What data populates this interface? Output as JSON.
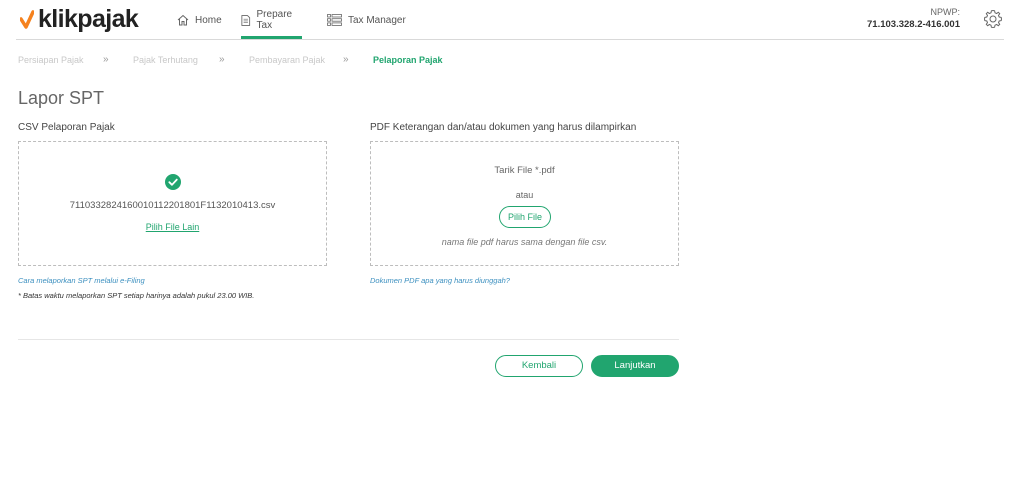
{
  "brand": {
    "name": "klikpajak",
    "accent": "#21a56f",
    "logo_mark_color": "#f5821f"
  },
  "nav": {
    "home": {
      "label": "Home",
      "icon": "home-icon"
    },
    "prepare_tax": {
      "label": "Prepare Tax",
      "icon": "document-icon",
      "active": true
    },
    "tax_manager": {
      "label": "Tax Manager",
      "icon": "list-icon"
    }
  },
  "account": {
    "npwp_label": "NPWP:",
    "npwp_value": "71.103.328.2-416.001",
    "settings_icon": "gear-icon"
  },
  "breadcrumb": {
    "steps": [
      "Persiapan Pajak",
      "Pajak Terhutang",
      "Pembayaran Pajak",
      "Pelaporan Pajak"
    ],
    "separator": "»",
    "active_index": 3
  },
  "page": {
    "title": "Lapor SPT"
  },
  "csv_section": {
    "label": "CSV Pelaporan Pajak",
    "status_icon": "check-circle-icon",
    "filename": "711033282416001011220180 1F1132010413.csv",
    "pick_other_label": "Pilih File Lain",
    "help_link": "Cara melaporkan SPT melalui e-Filing",
    "deadline_note": "* Batas waktu melaporkan SPT setiap harinya adalah pukul 23.00 WIB."
  },
  "pdf_section": {
    "label": "PDF Keterangan dan/atau dokumen yang harus dilampirkan",
    "drag_text": "Tarik File *.pdf",
    "or_text": "atau",
    "pick_button": "Pilih File",
    "hint": "nama file pdf harus sama dengan file csv.",
    "help_link": "Dokumen PDF apa yang harus diunggah?"
  },
  "actions": {
    "back": "Kembali",
    "next": "Lanjutkan"
  }
}
